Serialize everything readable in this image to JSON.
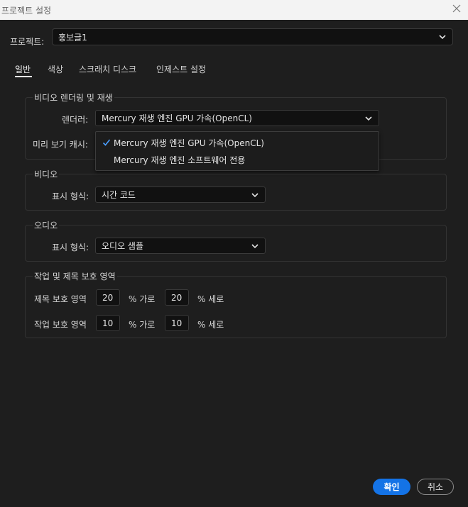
{
  "window": {
    "title": "프로젝트 설정"
  },
  "project": {
    "label": "프로젝트:",
    "value": "홍보글1"
  },
  "tabs": [
    {
      "label": "일반",
      "active": true
    },
    {
      "label": "색상",
      "active": false
    },
    {
      "label": "스크래치 디스크",
      "active": false
    },
    {
      "label": "인제스트 설정",
      "active": false
    }
  ],
  "video_rendering": {
    "title": "비디오 렌더링 및 재생",
    "renderer_label": "렌더러:",
    "renderer_value": "Mercury 재생 엔진 GPU 가속(OpenCL)",
    "preview_cache_label": "미리 보기 캐시:",
    "renderer_options": [
      {
        "label": "Mercury 재생 엔진 GPU 가속(OpenCL)",
        "selected": true
      },
      {
        "label": "Mercury 재생 엔진 소프트웨어 전용",
        "selected": false
      }
    ]
  },
  "video": {
    "title": "비디오",
    "display_label": "표시 형식:",
    "display_value": "시간 코드"
  },
  "audio": {
    "title": "오디오",
    "display_label": "표시 형식:",
    "display_value": "오디오 샘플"
  },
  "safe_margins": {
    "title": "작업 및 제목 보호 영역",
    "title_safe": {
      "label": "제목 보호 영역",
      "h": "20",
      "h_unit": "% 가로",
      "v": "20",
      "v_unit": "% 세로"
    },
    "action_safe": {
      "label": "작업 보호 영역",
      "h": "10",
      "h_unit": "% 가로",
      "v": "10",
      "v_unit": "% 세로"
    }
  },
  "buttons": {
    "ok": "확인",
    "cancel": "취소"
  },
  "colors": {
    "accent": "#1473e6",
    "background": "#1e1e1e",
    "titlebar": "#f3f3f3"
  }
}
